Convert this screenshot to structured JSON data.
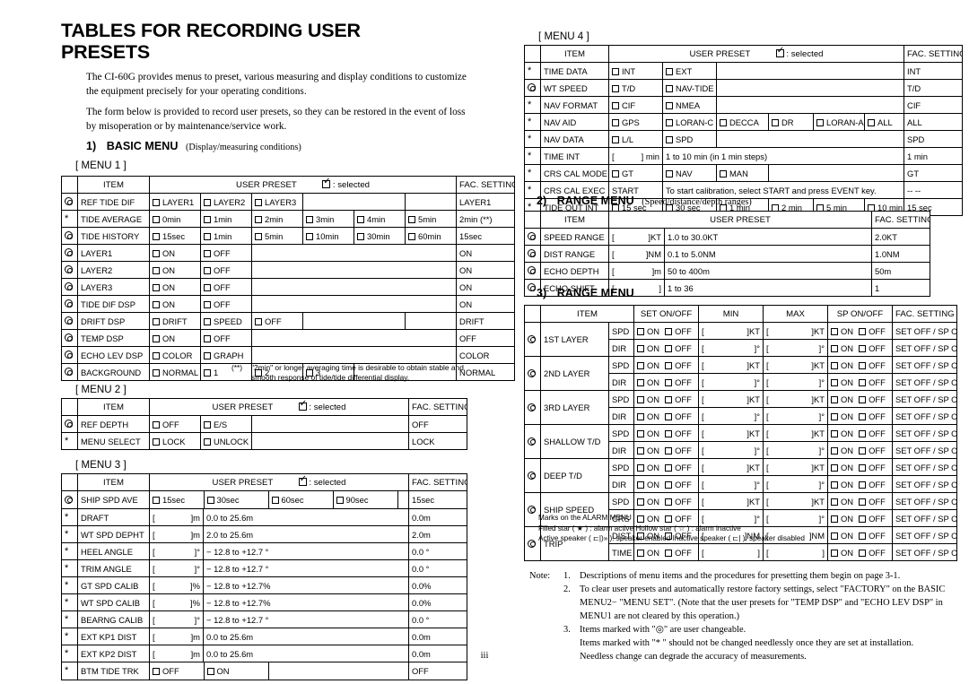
{
  "document": {
    "title": "TABLES FOR RECORDING USER PRESETS",
    "intro_p1": "The CI-60G provides menus to preset, various measuring and display conditions to customize the equipment precisely for your operating conditions.",
    "intro_p2": "The form below is provided to record user presets, so they can be restored in the event of loss by misoperation or by maintenance/service work.",
    "page_number": "iii"
  },
  "common": {
    "col_item": "ITEM",
    "col_user_preset": "USER  PRESET",
    "col_selected": ": selected",
    "col_fac_setting": "FAC. SETTING",
    "mark_user": "◎",
    "mark_star": "*"
  },
  "sections": {
    "basic_menu": {
      "num": "1)",
      "title": "BASIC MENU",
      "sub": "(Display/measuring conditions)"
    },
    "range_menu_2": {
      "num": "2)",
      "title": "RANGE MENU",
      "sub": "(Speed/distance/depth ranges)"
    },
    "range_menu_3": {
      "num": "3)",
      "title": "RANGE MENU",
      "sub": ""
    }
  },
  "menu1": {
    "label": "[ MENU 1 ]",
    "rows": [
      {
        "mark": "◎",
        "item": "REF TIDE DIF",
        "opts": [
          "LAYER1",
          "LAYER2",
          "LAYER3"
        ],
        "fac": "LAYER1"
      },
      {
        "mark": "*",
        "item": "TIDE AVERAGE",
        "opts": [
          "0min",
          "1min",
          "2min",
          "3min",
          "4min",
          "5min"
        ],
        "fac": "2min (**)"
      },
      {
        "mark": "◎",
        "item": "TIDE HISTORY",
        "opts": [
          "15sec",
          "1min",
          "5min",
          "10min",
          "30min",
          "60min"
        ],
        "fac": "15sec"
      },
      {
        "mark": "◎",
        "item": "LAYER1",
        "opts": [
          "ON",
          "OFF"
        ],
        "fac": "ON"
      },
      {
        "mark": "◎",
        "item": "LAYER2",
        "opts": [
          "ON",
          "OFF"
        ],
        "fac": "ON"
      },
      {
        "mark": "◎",
        "item": "LAYER3",
        "opts": [
          "ON",
          "OFF"
        ],
        "fac": "ON"
      },
      {
        "mark": "◎",
        "item": "TIDE DIF DSP",
        "opts": [
          "ON",
          "OFF"
        ],
        "fac": "ON"
      },
      {
        "mark": "◎",
        "item": "DRIFT DSP",
        "opts": [
          "DRIFT",
          "SPEED",
          "OFF"
        ],
        "fac": "DRIFT"
      },
      {
        "mark": "◎",
        "item": "TEMP DSP",
        "opts": [
          "ON",
          "OFF"
        ],
        "fac": "OFF"
      },
      {
        "mark": "◎",
        "item": "ECHO LEV DSP",
        "opts": [
          "COLOR",
          "GRAPH"
        ],
        "fac": "COLOR"
      },
      {
        "mark": "◎",
        "item": "BACKGROUND",
        "opts": [
          "NORMAL",
          "1",
          "2",
          "3"
        ],
        "fac": "NORMAL"
      }
    ],
    "footnote_mark": "(**)",
    "footnote_l1": "\"2min\" or longer averaging time is desirable to obtain stable and",
    "footnote_l2": "smooth response of tide/tide differential display."
  },
  "menu2": {
    "label": "[ MENU 2 ]",
    "rows": [
      {
        "mark": "◎",
        "item": "REF DEPTH",
        "opts": [
          "OFF",
          "E/S"
        ],
        "fac": "OFF"
      },
      {
        "mark": "*",
        "item": "MENU SELECT",
        "opts": [
          "LOCK",
          "UNLOCK"
        ],
        "fac": "LOCK"
      }
    ]
  },
  "menu3": {
    "label": "[ MENU 3 ]",
    "rows": [
      {
        "mark": "◎",
        "item": "SHIP SPD AVE",
        "type": "opts",
        "opts": [
          "15sec",
          "30sec",
          "60sec",
          "90sec"
        ],
        "fac": "15sec"
      },
      {
        "mark": "*",
        "item": "DRAFT",
        "type": "field",
        "unit": "]m",
        "range": "0.0 to 25.6m",
        "fac": "0.0m"
      },
      {
        "mark": "*",
        "item": "WT SPD DEPHT",
        "type": "field",
        "unit": "]m",
        "range": "2.0 to 25.6m",
        "fac": "2.0m"
      },
      {
        "mark": "*",
        "item": "HEEL ANGLE",
        "type": "field",
        "unit": "]°",
        "range": "− 12.8 to +12.7 °",
        "fac": "0.0 °"
      },
      {
        "mark": "*",
        "item": "TRIM ANGLE",
        "type": "field",
        "unit": "]°",
        "range": "− 12.8 to +12.7 °",
        "fac": "0.0 °"
      },
      {
        "mark": "*",
        "item": "GT SPD CALIB",
        "type": "field",
        "unit": "]%",
        "range": "− 12.8 to +12.7%",
        "fac": "0.0%"
      },
      {
        "mark": "*",
        "item": "WT SPD CALIB",
        "type": "field",
        "unit": "]%",
        "range": "− 12.8 to +12.7%",
        "fac": "0.0%"
      },
      {
        "mark": "*",
        "item": "BEARNG CALIB",
        "type": "field",
        "unit": "]°",
        "range": "− 12.8 to +12.7 °",
        "fac": "0.0 °"
      },
      {
        "mark": "*",
        "item": "EXT KP1 DIST",
        "type": "field",
        "unit": "]m",
        "range": "0.0  to 25.6m",
        "fac": "0.0m"
      },
      {
        "mark": "*",
        "item": "EXT KP2 DIST",
        "type": "field",
        "unit": "]m",
        "range": "0.0  to 25.6m",
        "fac": "0.0m"
      },
      {
        "mark": "*",
        "item": "BTM TIDE TRK",
        "type": "opts",
        "opts": [
          "OFF",
          "ON"
        ],
        "fac": "OFF"
      }
    ]
  },
  "menu4": {
    "label": "[ MENU 4 ]",
    "rows": [
      {
        "mark": "*",
        "item": "TIME DATA",
        "type": "opts",
        "opts": [
          "INT",
          "EXT"
        ],
        "fac": "INT"
      },
      {
        "mark": "◎",
        "item": "WT SPEED",
        "type": "opts",
        "opts": [
          "T/D",
          "NAV-TIDE"
        ],
        "fac": "T/D"
      },
      {
        "mark": "*",
        "item": "NAV FORMAT",
        "type": "opts",
        "opts": [
          "CIF",
          "NMEA"
        ],
        "fac": "CIF"
      },
      {
        "mark": "*",
        "item": "NAV AID",
        "type": "navaid",
        "opts": [
          "GPS",
          "LORAN-C",
          "DECCA",
          "DR",
          "LORAN-A",
          "ALL"
        ],
        "fac": "ALL"
      },
      {
        "mark": "*",
        "item": "NAV DATA",
        "type": "opts",
        "opts": [
          "L/L",
          "SPD"
        ],
        "fac": "SPD"
      },
      {
        "mark": "*",
        "item": "TIME INT",
        "type": "field",
        "unit": "] min",
        "range": "1 to 10 min (in 1 min steps)",
        "fac": "1 min"
      },
      {
        "mark": "*",
        "item": "CRS CAL MODE",
        "type": "opts",
        "opts": [
          "GT",
          "NAV",
          "MAN"
        ],
        "fac": "GT"
      },
      {
        "mark": "*",
        "item": "CRS CAL EXEC",
        "type": "exec",
        "action": "START",
        "desc": "To start calibration, select START and press EVENT key.",
        "fac": "-- --"
      },
      {
        "mark": "*",
        "item": "TIDE OUT INT",
        "type": "opts6",
        "opts": [
          "15 sec",
          "30 sec",
          "1 min",
          "2 min",
          "5 min",
          "10 min"
        ],
        "fac": "15 sec"
      }
    ]
  },
  "range2": {
    "rows": [
      {
        "mark": "◎",
        "item": "SPEED RANGE",
        "unit": "]KT",
        "range": "1.0  to  30.0KT",
        "fac": "2.0KT"
      },
      {
        "mark": "◎",
        "item": "DIST RANGE",
        "unit": "]NM",
        "range": "0.1  to  5.0NM",
        "fac": "1.0NM"
      },
      {
        "mark": "◎",
        "item": "ECHO DEPTH",
        "unit": "]m",
        "range": "50  to  400m",
        "fac": "50m"
      },
      {
        "mark": "◎",
        "item": "ECHO SHIFT",
        "unit": "]",
        "range": "1  to  36",
        "fac": "1"
      }
    ]
  },
  "range3": {
    "headers": [
      "ITEM",
      "SET ON/OFF",
      "MIN",
      "MAX",
      "SP ON/OFF",
      "FAC. SETTING"
    ],
    "on_label": "ON",
    "off_label": "OFF",
    "fac_value": "SET OFF / SP ON",
    "groups": [
      {
        "mark": "◎",
        "item": "1ST LAYER",
        "subs": [
          {
            "sub": "SPD",
            "min_unit": "]KT",
            "max_unit": "]KT"
          },
          {
            "sub": "DIR",
            "min_unit": "]°",
            "max_unit": "]°"
          }
        ]
      },
      {
        "mark": "◎",
        "item": "2ND LAYER",
        "subs": [
          {
            "sub": "SPD",
            "min_unit": "]KT",
            "max_unit": "]KT"
          },
          {
            "sub": "DIR",
            "min_unit": "]°",
            "max_unit": "]°"
          }
        ]
      },
      {
        "mark": "◎",
        "item": "3RD LAYER",
        "subs": [
          {
            "sub": "SPD",
            "min_unit": "]KT",
            "max_unit": "]KT"
          },
          {
            "sub": "DIR",
            "min_unit": "]°",
            "max_unit": "]°"
          }
        ]
      },
      {
        "mark": "◎",
        "item": "SHALLOW T/D",
        "subs": [
          {
            "sub": "SPD",
            "min_unit": "]KT",
            "max_unit": "]KT"
          },
          {
            "sub": "DIR",
            "min_unit": "]°",
            "max_unit": "]°"
          }
        ]
      },
      {
        "mark": "◎",
        "item": "DEEP T/D",
        "subs": [
          {
            "sub": "SPD",
            "min_unit": "]KT",
            "max_unit": "]KT"
          },
          {
            "sub": "DIR",
            "min_unit": "]°",
            "max_unit": "]°"
          }
        ]
      },
      {
        "mark": "◎",
        "item": "SHIP SPEED",
        "subs": [
          {
            "sub": "SPD",
            "min_unit": "]KT",
            "max_unit": "]KT"
          },
          {
            "sub": "CRS",
            "min_unit": "]°",
            "max_unit": "]°"
          }
        ]
      },
      {
        "mark": "◎",
        "item": "TRIP",
        "subs": [
          {
            "sub": "DIST",
            "min_unit": "]NM",
            "max_unit": "]NM"
          },
          {
            "sub": "TIME",
            "min_unit": "]",
            "max_unit": "]"
          }
        ]
      }
    ]
  },
  "marks_legend": {
    "title": "Marks on the ALARM MENU",
    "line2": "Filled star ( ★ ) : alarm active   Hollow star ( ☆ ) : alarm inactive",
    "line3": "Active speaker ( ⊏|)» ): speaker enabled     Inactive speaker ( ⊏| ): speaker disabled"
  },
  "notes": {
    "label": "Note:",
    "items": [
      {
        "num": "1.",
        "text": "Descriptions of menu items and the procedures for presetting them begin on page 3-1."
      },
      {
        "num": "2.",
        "text": "To clear user presets and automatically restore factory settings, select \"FACTORY\" on the BASIC MENU2− \"MENU SET\".  (Note that the user presets for \"TEMP DSP\" and \"ECHO LEV DSP\" in MENU1 are not cleared by this operation.)"
      },
      {
        "num": "3.",
        "text": "Items marked with \"◎\" are user changeable."
      }
    ],
    "item3_cont1": "Items marked with \"* \" should not be changed needlessly once they are set at installation.",
    "item3_cont2": "Needless change can degrade the accuracy of measurements."
  }
}
